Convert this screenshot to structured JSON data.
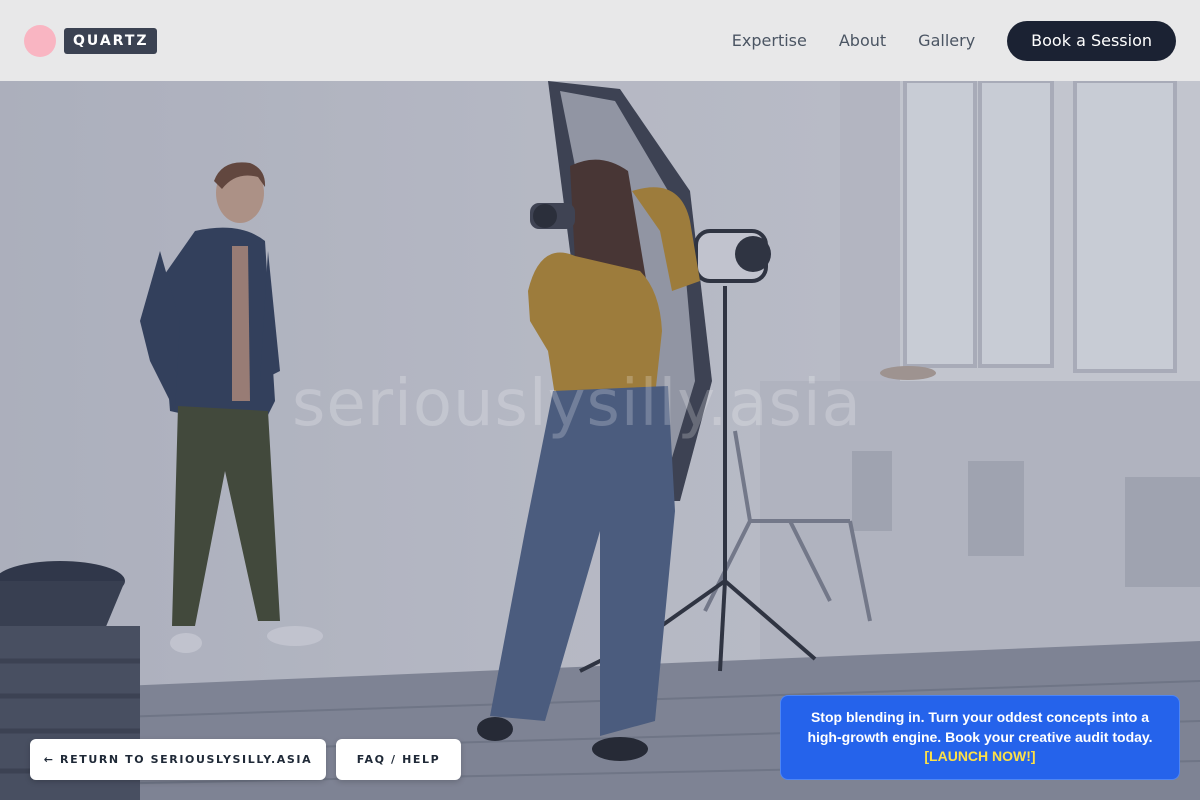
{
  "header": {
    "logo_text": "QUARTZ",
    "nav": [
      {
        "label": "Expertise"
      },
      {
        "label": "About"
      },
      {
        "label": "Gallery"
      }
    ],
    "cta_label": "Book a Session"
  },
  "hero": {
    "watermark": "seriouslysilly.asia"
  },
  "footer_buttons": {
    "return_label": "← RETURN TO SERIOUSLYSILLY.ASIA",
    "faq_label": "FAQ / HELP"
  },
  "promo": {
    "text": "Stop blending in. Turn your oddest concepts into a high-growth engine. Book your creative audit today.",
    "link_label": "[LAUNCH NOW!]"
  },
  "colors": {
    "header_bg": "#e8e8e9",
    "logo_dot": "#f9b5c2",
    "logo_bg": "#3b4252",
    "cta_bg": "#1b2233",
    "promo_bg": "#2563eb",
    "promo_link": "#fde047"
  }
}
